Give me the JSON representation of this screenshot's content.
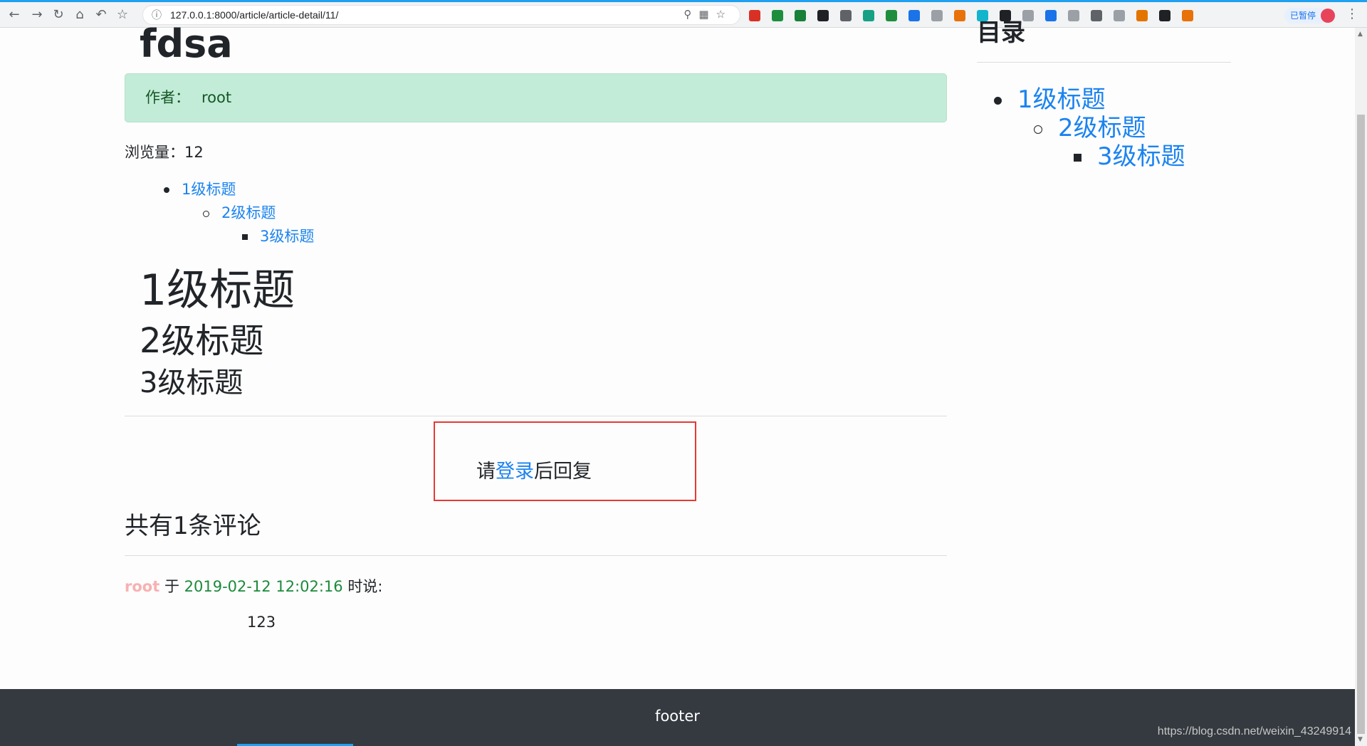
{
  "browser": {
    "url": "127.0.0.1:8000/article/article-detail/11/",
    "paused_label": "已暂停",
    "icons": [
      "back-icon",
      "forward-icon",
      "reload-icon",
      "home-icon",
      "undo-icon",
      "bookmark-star-icon",
      "info-icon",
      "zoom-icon",
      "qr-icon",
      "star-icon",
      "menu-icon"
    ],
    "extension_colors": [
      "#d93025",
      "#1e8e3e",
      "#188038",
      "#202124",
      "#5f6368",
      "#16a086",
      "#1e8e3e",
      "#1a73e8",
      "#9aa0a6",
      "#e8710a",
      "#12b5cb",
      "#202124",
      "#9aa0a6",
      "#1a73e8",
      "#9aa0a6",
      "#5f6368",
      "#9aa0a6",
      "#e37400",
      "#202124",
      "#e8710a"
    ]
  },
  "article": {
    "title": "fdsa",
    "author_label": "作者：",
    "author_name": "root",
    "views_label": "浏览量：",
    "views_count": "12",
    "toc": [
      "1级标题",
      "2级标题",
      "3级标题"
    ],
    "headings": {
      "h1": "1级标题",
      "h2": "2级标题",
      "h3": "3级标题"
    }
  },
  "reply": {
    "prefix": "请",
    "login_link": "登录",
    "suffix": "后回复",
    "highlight_color": "#e53935"
  },
  "comments": {
    "heading": "共有1条评论",
    "items": [
      {
        "user": "root",
        "connector": "于",
        "time": "2019-02-12 12:02:16",
        "said": "时说:",
        "body": "123"
      }
    ]
  },
  "sidebar": {
    "title": "目录",
    "toc": [
      "1级标题",
      "2级标题",
      "3级标题"
    ]
  },
  "footer": {
    "text": "footer"
  },
  "watermark": "https://blog.csdn.net/weixin_43249914",
  "colors": {
    "link": "#1b83f0",
    "alert_bg": "#c3ecd8",
    "footer_bg": "#343a40",
    "time": "#1c8a3c",
    "username": "#f8b1b1"
  }
}
